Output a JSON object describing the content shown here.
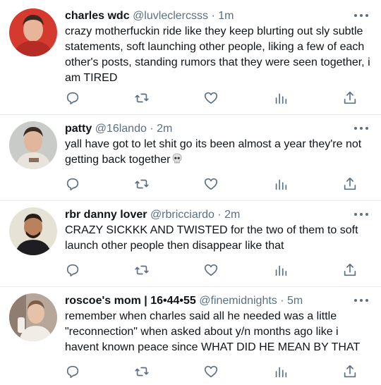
{
  "tweets": [
    {
      "name": "charles wdc",
      "handle": "@luvleclercsss",
      "sep": " · ",
      "time": "1m",
      "text": "crazy motherfuckin ride like they keep blurting out sly subtle statements, soft launching other people, liking a few of each other's posts, standing rumors that they were seen together, i am TIRED",
      "avatar_colors": {
        "bg": "#d63a2f",
        "skin": "#e8b49a",
        "hair": "#3a2a22"
      }
    },
    {
      "name": "patty",
      "handle": "@16lando",
      "sep": " · ",
      "time": "2m",
      "text": "yall have got to let shit go its been almost a year they're not getting back together",
      "emoji": "skull-emoji",
      "avatar_colors": {
        "bg": "#c9cbc8",
        "skin": "#e0b79c",
        "hair": "#3b2c22"
      }
    },
    {
      "name": "rbr danny lover",
      "handle": "@rbricciardo",
      "sep": " · ",
      "time": "2m",
      "text": "CRAZY SICKKK AND TWISTED for the two of them to soft launch other people then disappear like that",
      "avatar_colors": {
        "bg": "#e7e2d6",
        "skin": "#b9825d",
        "hair": "#2a1d16"
      }
    },
    {
      "name": "roscoe's mom | 16•44•55",
      "handle": "@finemidnights",
      "sep": " · ",
      "time": "5m",
      "text": "remember when charles said all he needed was a little \"reconnection\" when asked about y/n months ago like i havent known peace since WHAT DID HE MEAN BY THAT",
      "avatar_colors": {
        "bg": "#b7a79a",
        "skin": "#e6c2a8",
        "hair": "#7c5a43"
      }
    }
  ],
  "icons": {
    "reply": "reply-icon",
    "retweet": "retweet-icon",
    "like": "like-icon",
    "stats": "analytics-icon",
    "share": "share-icon",
    "more": "more-options-icon"
  },
  "colors": {
    "icon": "#5b7083",
    "divider": "#e6ecf0"
  }
}
